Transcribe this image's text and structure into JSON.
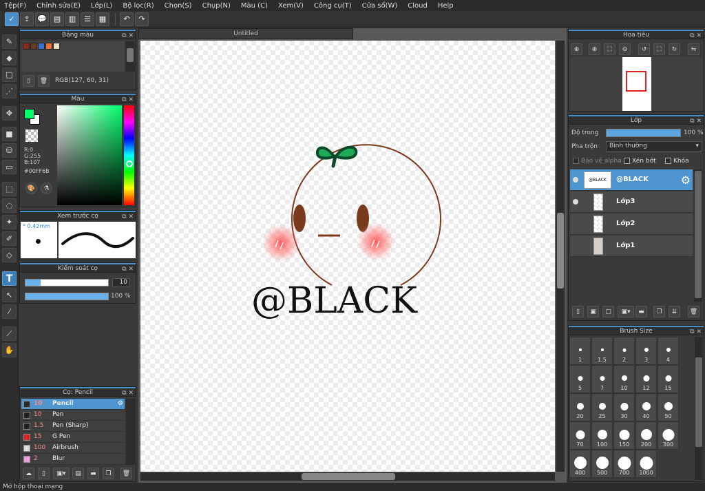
{
  "menu": [
    "Tệp(F)",
    "Chỉnh sửa(E)",
    "Lớp(L)",
    "Bộ lọc(R)",
    "Chọn(S)",
    "Chụp(N)",
    "Màu (C)",
    "Xem(V)",
    "Công cụ(T)",
    "Cửa sổ(W)",
    "Cloud",
    "Help"
  ],
  "palette": {
    "title": "Bảng màu",
    "rgb_readout": "RGB(127, 60, 31)",
    "swatches": [
      "#8b2a1a",
      "#6d3a20",
      "#3a6fd0",
      "#f07030",
      "#e8e0c0"
    ]
  },
  "color": {
    "title": "Màu",
    "r": "R:0",
    "g": "G:255",
    "b": "B:107",
    "hex": "#00FF6B",
    "fg": "#00ff6b",
    "bg": "#ffffff"
  },
  "preview": {
    "title": "Xem trước cọ",
    "size": "0.42mm"
  },
  "brush_control": {
    "title": "Kiểm soát cọ",
    "size_value": "10",
    "opacity_value": "100 %",
    "size_fraction": 0.18,
    "opacity_fraction": 1.0
  },
  "brush_list": {
    "title": "Cọ: Pencil",
    "items": [
      {
        "size": "10",
        "name": "Pencil",
        "color": "#2a2a2a",
        "selected": true
      },
      {
        "size": "10",
        "name": "Pen",
        "color": "#222222"
      },
      {
        "size": "1.5",
        "name": "Pen (Sharp)",
        "color": "#222222"
      },
      {
        "size": "15",
        "name": "G Pen",
        "color": "#e02020"
      },
      {
        "size": "100",
        "name": "Airbrush",
        "color": "#dddddd"
      },
      {
        "size": "2",
        "name": "Blur",
        "color": "#f0a0e0"
      }
    ]
  },
  "document": {
    "tab": "Untitled",
    "signature": "@BLACK"
  },
  "navigator": {
    "title": "Hoa tiêu"
  },
  "layers": {
    "title": "Lớp",
    "opacity_label": "Độ trong",
    "opacity_value": "100 %",
    "opacity_fraction": 1.0,
    "blend_label": "Pha trộn",
    "blend_value": "Bình thường",
    "alpha_protect": "Bảo vệ alpha",
    "clipping": "Xén bớt",
    "lock": "Khóa",
    "items": [
      {
        "name": "@BLACK",
        "thumb": "@BLACK",
        "selected": true
      },
      {
        "name": "Lớp3"
      },
      {
        "name": "Lớp2"
      },
      {
        "name": "Lớp1"
      }
    ]
  },
  "brush_size": {
    "title": "Brush Size",
    "sizes": [
      "1",
      "1.5",
      "2",
      "3",
      "4",
      "5",
      "7",
      "10",
      "12",
      "15",
      "20",
      "25",
      "30",
      "40",
      "50",
      "70",
      "100",
      "150",
      "200",
      "300",
      "400",
      "500",
      "700",
      "1000"
    ]
  },
  "status": "Mở hộp thoại mạng"
}
